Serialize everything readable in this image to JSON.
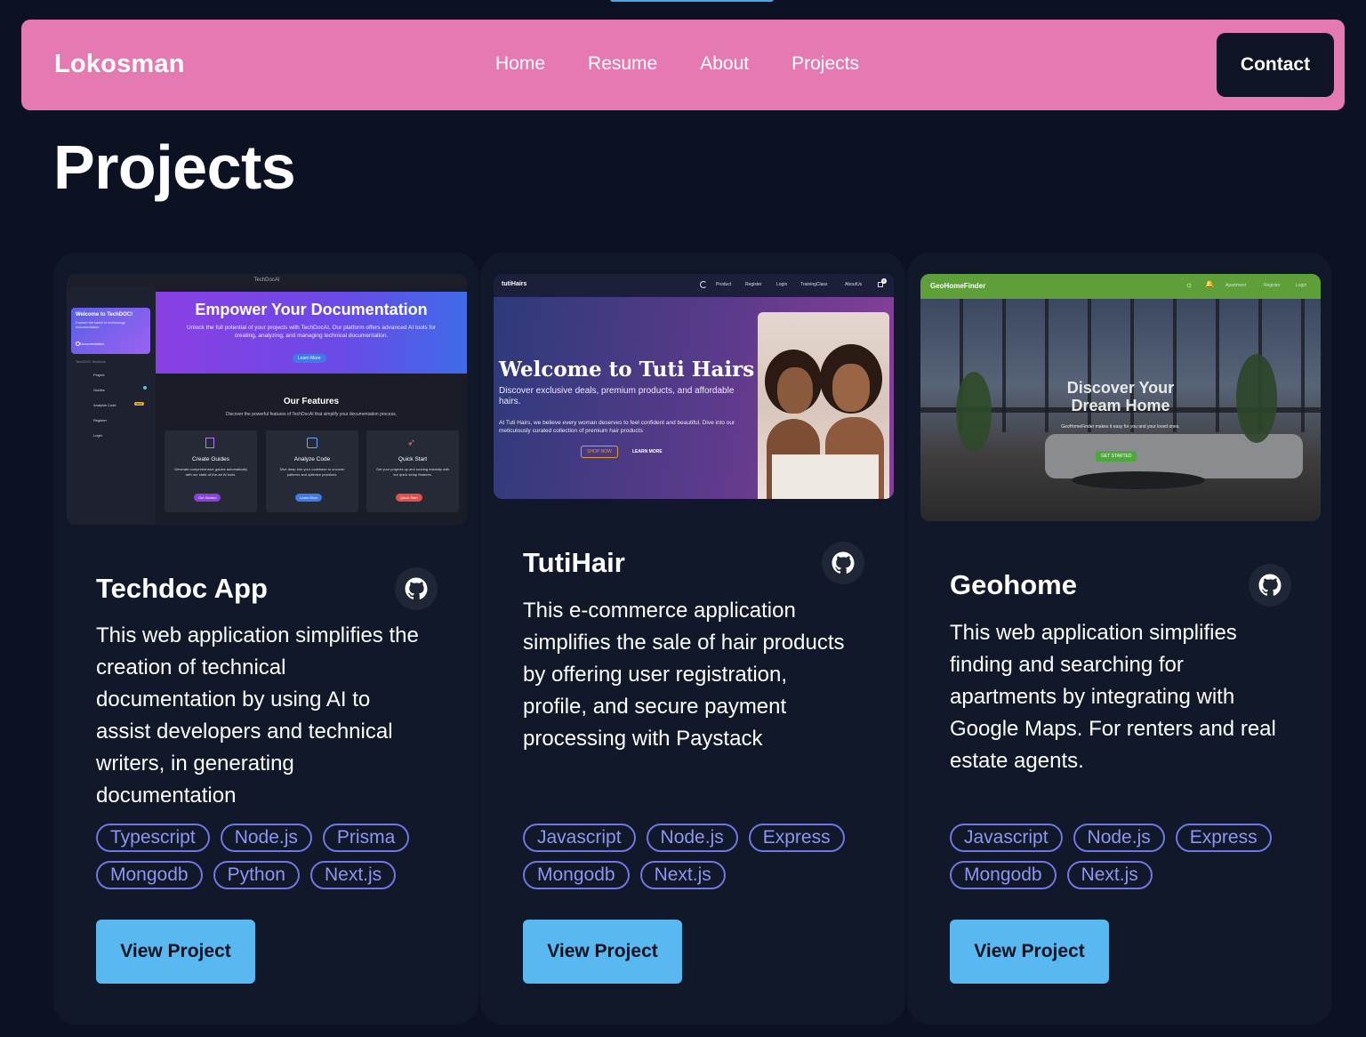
{
  "nav": {
    "brand": "Lokosman",
    "links": [
      "Home",
      "Resume",
      "About",
      "Projects"
    ],
    "contact": "Contact"
  },
  "page": {
    "title": "Projects"
  },
  "projects": [
    {
      "title": "Techdoc App",
      "description": "This web application simplifies the creation of technical documentation by using AI to assist developers and technical writers, in generating documentation",
      "tags": [
        "Typescript",
        "Node.js",
        "Prisma",
        "Mongodb",
        "Python",
        "Next.js"
      ],
      "button": "View Project",
      "preview": {
        "app_title": "TechDocAI",
        "welcome_title": "Welcome to TechDOC!",
        "welcome_text": "Explore the latest in technology documentation.",
        "welcome_link": "Documentation",
        "sidebar_heading": "TechDOC Sections",
        "sidebar": [
          "Project",
          "Guides",
          "Analysis Code",
          "Register",
          "Login"
        ],
        "sidebar_badge": "NEW",
        "hero_title": "Empower Your Documentation",
        "hero_text": "Unlock the full potential of your projects with TechDocAI. Our platform offers advanced AI tools for creating, analyzing, and managing technical documentation.",
        "hero_button": "Learn More",
        "features_title": "Our Features",
        "features_sub": "Discover the powerful features of TechDocAI that simplify your documentation process.",
        "features": [
          {
            "name": "Create Guides",
            "text": "Generate comprehensive guides automatically with our state-of-the-art AI tools.",
            "button": "Get Started"
          },
          {
            "name": "Analyze Code",
            "text": "Dive deep into your codebase to uncover patterns and optimize practices.",
            "button": "Learn More"
          },
          {
            "name": "Quick Start",
            "text": "Get your projects up and running instantly with our quick setup features.",
            "button": "Quick Start"
          }
        ]
      }
    },
    {
      "title": "TutiHair",
      "description": "This e-commerce application simplifies the sale of hair products by offering user registration, profile, and secure payment processing with Paystack",
      "tags": [
        "Javascript",
        "Node.js",
        "Express",
        "Mongodb",
        "Next.js"
      ],
      "button": "View Project",
      "preview": {
        "brand": "tutiHairs",
        "nav": [
          "Product",
          "Register",
          "Login",
          "TrainingClass",
          "AboutUs"
        ],
        "cart_count": "0",
        "hero_title": "Welcome to Tuti Hairs",
        "hero_sub": "Discover exclusive deals, premium products, and affordable hairs.",
        "hero_text": "At Tuti Hairs, we believe every woman deserves to feel confident and beautiful. Dive into our meticulously curated collection of premium hair products",
        "shop_button": "SHOP NOW",
        "learn_button": "LEARN MORE"
      }
    },
    {
      "title": "Geohome",
      "description": "This web application simplifies finding and searching for apartments by integrating with Google Maps. For renters and real estate agents.",
      "tags": [
        "Javascript",
        "Node.js",
        "Express",
        "Mongodb",
        "Next.js"
      ],
      "button": "View Project",
      "preview": {
        "brand": "GeoHomeFinder",
        "nav": [
          "Apartment",
          "Register",
          "Login"
        ],
        "hero_title": "Discover Your Dream Home",
        "hero_text": "GeoHomeFinder makes it easy for you and your loved ones.",
        "hero_button": "GET STARTED"
      }
    }
  ],
  "colors": {
    "background": "#0c1221",
    "navbar": "#e57ab2",
    "card": "#111829",
    "tag_border": "#6f78e2",
    "tag_text": "#8d96f0",
    "button": "#5ab8f0"
  },
  "icons": [
    "github-icon",
    "moon-icon",
    "cart-icon",
    "sun-icon",
    "bell-icon",
    "file-icon",
    "code-icon",
    "rocket-icon"
  ]
}
